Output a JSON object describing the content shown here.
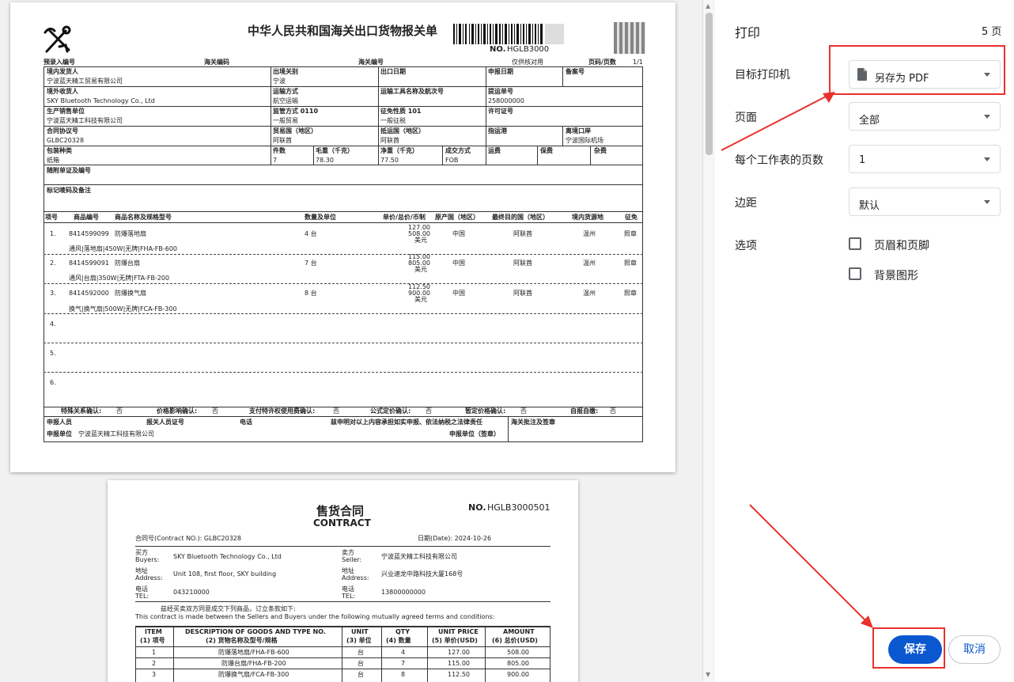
{
  "print_panel": {
    "title": "打印",
    "page_count": "5 页",
    "destination_label": "目标打印机",
    "destination_value": "另存为 PDF",
    "pages_label": "页面",
    "pages_value": "全部",
    "pages_per_sheet_label": "每个工作表的页数",
    "pages_per_sheet_value": "1",
    "margins_label": "边距",
    "margins_value": "默认",
    "options_label": "选项",
    "opt_headers": "页眉和页脚",
    "opt_background": "背景图形",
    "save_button": "保存",
    "cancel_button": "取消",
    "accent_color": "#1a73e8",
    "annotation_color": "#e8312d"
  },
  "doc1": {
    "title": "中华人民共和国海关出口货物报关单",
    "no_label": "NO.",
    "no_value": "HGLB3000",
    "preentry": "预录入编号",
    "customs_code_l": "海关编码",
    "customs_code_r": "海关编号",
    "verify": "仅供核对用",
    "page_label": "页码/页数",
    "page_value": "1/1",
    "r1": {
      "a_l": "境内发货人",
      "a_v": "宁波蓝天精工贸易有限公司",
      "b_l": "出境关别",
      "b_v": "宁波",
      "c_l": "出口日期",
      "d_l": "申报日期",
      "e_l": "备案号"
    },
    "r2": {
      "a_l": "境外收货人",
      "a_v": "SKY Bluetooth Technology Co., Ltd",
      "b_l": "运输方式",
      "b_v": "航空运输",
      "c_l": "运输工具名称及航次号",
      "d_l": "提运单号",
      "d_v": "258000000"
    },
    "r3": {
      "a_l": "生产销售单位",
      "a_v": "宁波蓝天精工科技有限公司",
      "b_l": "监管方式 0110",
      "b_v": "一般贸易",
      "c_l": "征免性质 101",
      "c_v": "一般征税",
      "d_l": "许可证号"
    },
    "r4": {
      "a_l": "合同协议号",
      "a_v": "GLBC20328",
      "b_l": "贸易国（地区）",
      "b_v": "阿联酋",
      "c_l": "抵运国（地区）",
      "c_v": "阿联酋",
      "d_l": "指运港",
      "e_l": "离境口岸",
      "e_v": "宁波国际机场"
    },
    "r5": {
      "a_l": "包装种类",
      "a_v": "纸箱",
      "pcs_l": "件数",
      "pcs_v": "7",
      "gw_l": "毛重（千克）",
      "gw_v": "78.30",
      "nw_l": "净重（千克）",
      "nw_v": "77.50",
      "tt_l": "成交方式",
      "tt_v": "FOB",
      "fr": "运费",
      "ins": "保费",
      "misc": "杂费"
    },
    "docs_label": "随附单证及编号",
    "marks_label": "标记唛码及备注",
    "cols": [
      "项号",
      "商品编号",
      "商品名称及规格型号",
      "数量及单位",
      "单价/总价/币制",
      "原产国（地区）",
      "最终目的国（地区）",
      "境内货源地",
      "征免"
    ],
    "items": [
      {
        "no": "1.",
        "code": "8414599099",
        "name": "防爆落地扇",
        "qty": "4 台",
        "unit": "127.00",
        "total": "508.00",
        "cur": "美元",
        "origin": "中国",
        "dest": "阿联酋",
        "src": "温州",
        "exempt": "照章",
        "spec": "通风|落地扇|450W|无牌|FHA-FB-600"
      },
      {
        "no": "2.",
        "code": "8414599091",
        "name": "防爆台扇",
        "qty": "7 台",
        "unit": "115.00",
        "total": "805.00",
        "cur": "美元",
        "origin": "中国",
        "dest": "阿联酋",
        "src": "温州",
        "exempt": "照章",
        "spec": "通风|台扇|350W|无牌|FTA-FB-200"
      },
      {
        "no": "3.",
        "code": "8414592000",
        "name": "防爆换气扇",
        "qty": "8 台",
        "unit": "112.50",
        "total": "900.00",
        "cur": "美元",
        "origin": "中国",
        "dest": "阿联酋",
        "src": "温州",
        "exempt": "照章",
        "spec": "换气|换气扇|500W|无牌|FCA-FB-300"
      }
    ],
    "empty_rows": [
      "4.",
      "5.",
      "6."
    ],
    "confirm": [
      {
        "l": "特殊关系确认:",
        "v": "否"
      },
      {
        "l": "价格影响确认:",
        "v": "否"
      },
      {
        "l": "支付特许权使用费确认:",
        "v": "否"
      },
      {
        "l": "公式定价确认:",
        "v": "否"
      },
      {
        "l": "暂定价格确认:",
        "v": "否"
      },
      {
        "l": "自报自缴:",
        "v": "否"
      }
    ],
    "declarant": "申报人员",
    "declarant_cert": "报关人员证号",
    "phone": "电话",
    "statement": "兹申明对以上内容承担如实申报、依法纳税之法律责任",
    "customs_note": "海关批注及签章",
    "decl_unit_l": "申报单位",
    "decl_unit_v": "宁波蓝天精工科技有限公司",
    "decl_sign": "申报单位（签章）"
  },
  "doc2": {
    "title_cn": "售货合同",
    "title_en": "CONTRACT",
    "no_label": "NO.",
    "no_value": "HGLB3000501",
    "contract_no": "合同号(Contract NO.):  GLBC20328",
    "date": "日期(Date):  2024-10-26",
    "buyers_l1": "买方",
    "buyers_l2": "Buyers:",
    "buyers_v": "SKY Bluetooth Technology Co., Ltd",
    "seller_l1": "卖方",
    "seller_l2": "Seller:",
    "seller_v": "宁波蓝天精工科技有限公司",
    "addr_l1": "地址",
    "addr_l2": "Address:",
    "addr_b": "Unit 108, first floor, SKY building",
    "addr_s": "兴业速龙中路科技大厦168号",
    "tel_l1": "电话",
    "tel_l2": "TEL:",
    "tel_b": "043210000",
    "tel_s": "13800000000",
    "intro_cn": "兹经买卖双方同意成交下列商品，订立条款如下:",
    "intro_en": "This contract is made between the Sellers and Buyers under the following mutually agreed terms and conditions:",
    "cols": [
      [
        "ITEM",
        "(1) 项号"
      ],
      [
        "DESCRIPTION OF GOODS AND TYPE NO.",
        "(2) 货物名称及型号/规格"
      ],
      [
        "UNIT",
        "(3) 单位"
      ],
      [
        "QTY",
        "(4) 数量"
      ],
      [
        "UNIT PRICE",
        "(5) 单价(USD)"
      ],
      [
        "AMOUNT",
        "(6) 总价(USD)"
      ]
    ],
    "rows": [
      [
        "1",
        "防爆落地扇/FHA-FB-600",
        "台",
        "4",
        "127.00",
        "508.00"
      ],
      [
        "2",
        "防爆台扇/FHA-FB-200",
        "台",
        "7",
        "115.00",
        "805.00"
      ],
      [
        "3",
        "防爆换气扇/FCA-FB-300",
        "台",
        "8",
        "112.50",
        "900.00"
      ]
    ]
  }
}
